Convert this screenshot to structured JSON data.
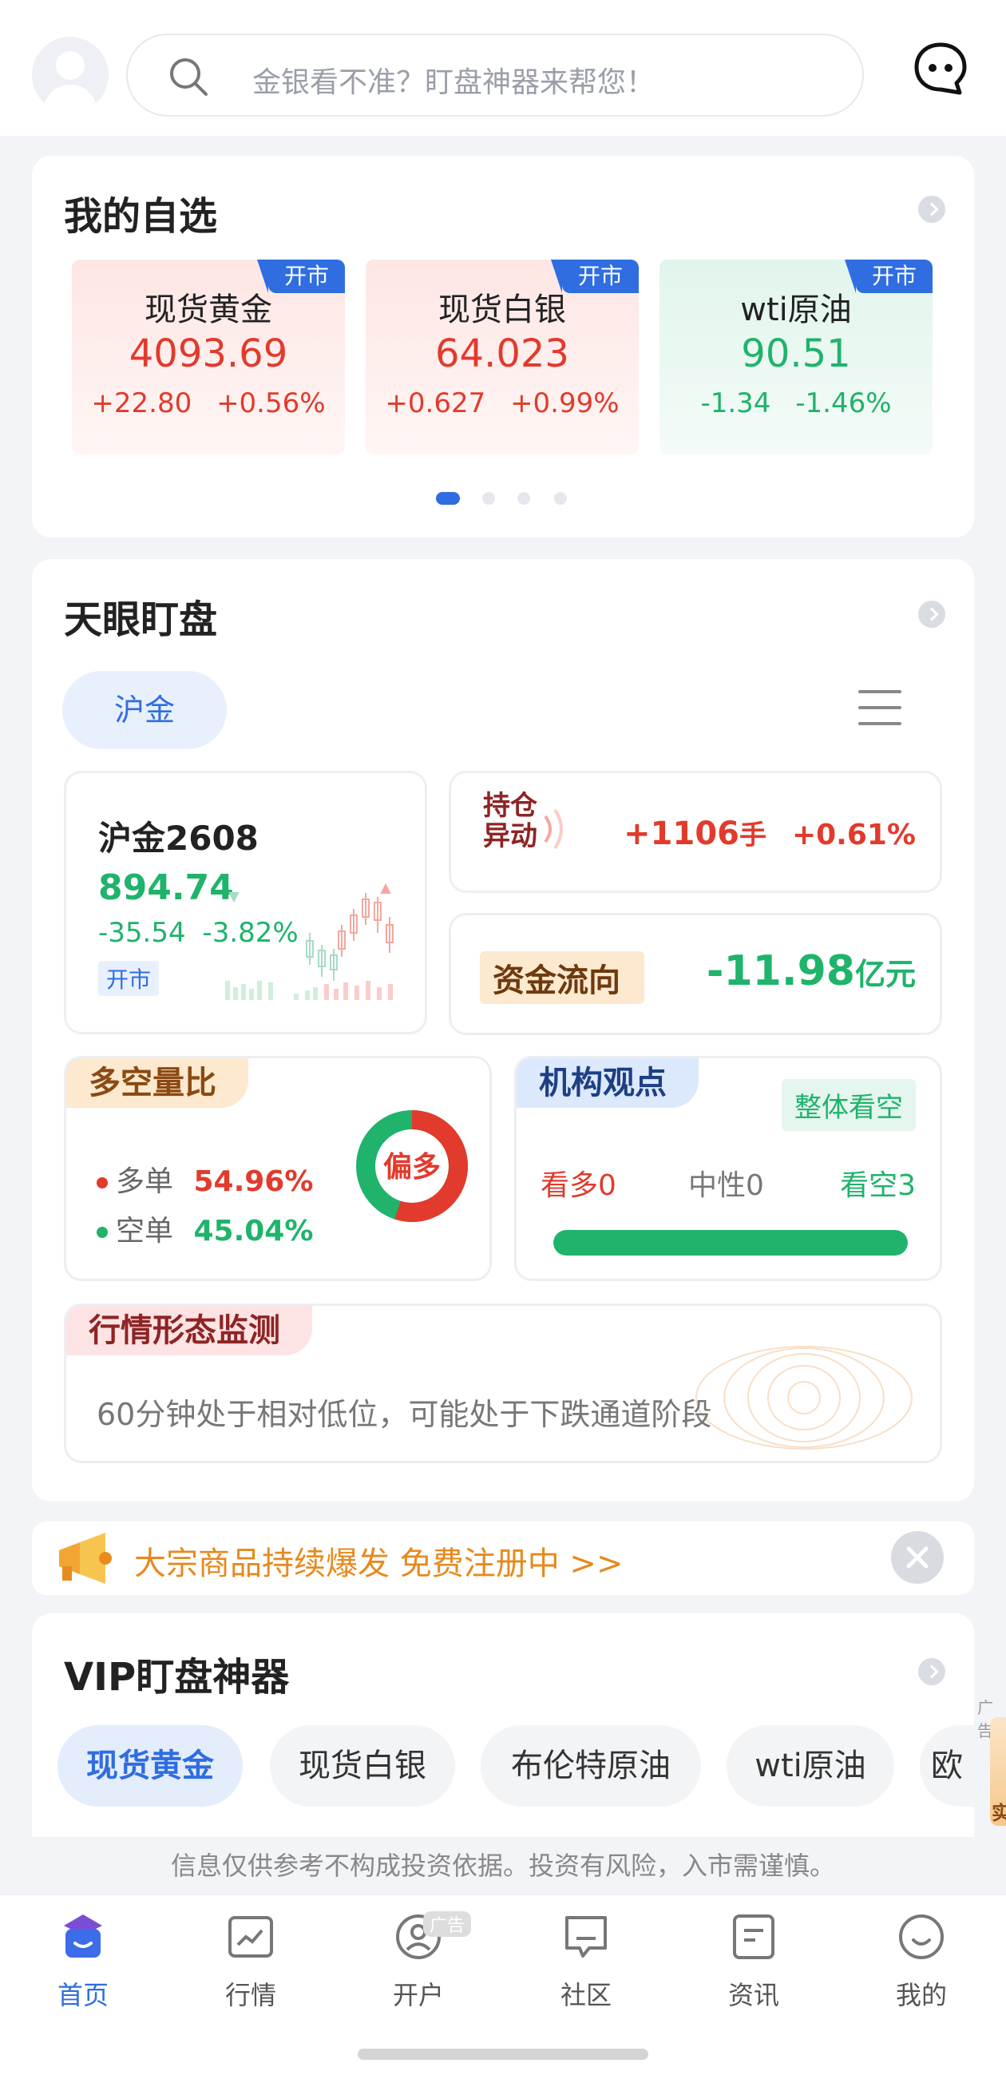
{
  "search": {
    "placeholder": "金银看不准？盯盘神器来帮您！"
  },
  "watchlist": {
    "title": "我的自选",
    "items": [
      {
        "name": "现货黄金",
        "price": "4093.69",
        "change": "+22.80",
        "pct": "+0.56%",
        "status": "开市",
        "trend": "up"
      },
      {
        "name": "现货白银",
        "price": "64.023",
        "change": "+0.627",
        "pct": "+0.99%",
        "status": "开市",
        "trend": "up"
      },
      {
        "name": "wti原油",
        "price": "90.51",
        "change": "-1.34",
        "pct": "-1.46%",
        "status": "开市",
        "trend": "down"
      }
    ],
    "page_count": 4,
    "active_page": 1
  },
  "tianyan": {
    "title": "天眼盯盘",
    "selected_tab": "沪金",
    "contract": {
      "name": "沪金2608",
      "price": "894.74",
      "change": "-35.54",
      "pct": "-3.82%",
      "status": "开市"
    },
    "position": {
      "tag_line1": "持仓",
      "tag_line2": "异动",
      "value": "+1106",
      "unit": "手",
      "pct": "+0.61%"
    },
    "fund_flow": {
      "label": "资金流向",
      "value": "-11.98",
      "unit": "亿元"
    },
    "long_short": {
      "title": "多空量比",
      "long_label": "多单",
      "long_value": "54.96%",
      "short_label": "空单",
      "short_value": "45.04%",
      "bias": "偏多",
      "long_ratio": 0.5496
    },
    "institution": {
      "title": "机构观点",
      "overall": "整体看空",
      "bull": "看多0",
      "neutral": "中性0",
      "bear": "看空3",
      "bear_ratio": 1.0
    },
    "pattern": {
      "title": "行情形态监测",
      "text": "60分钟处于相对低位，可能处于下跌通道阶段"
    }
  },
  "banner": {
    "text": "大宗商品持续爆发  免费注册中 >>"
  },
  "vip": {
    "title": "VIP盯盘神器",
    "tabs": [
      "现货黄金",
      "现货白银",
      "布伦特原油",
      "wti原油",
      "欧"
    ],
    "ad_label": "广告",
    "ad_text": "实"
  },
  "disclaimer": "信息仅供参考不构成投资依据。投资有风险，入市需谨慎。",
  "tabbar": {
    "items": [
      "首页",
      "行情",
      "开户",
      "社区",
      "资讯",
      "我的"
    ],
    "ad_badge": "广告"
  },
  "colors": {
    "up": "#e23a2c",
    "down": "#1fb36b",
    "accent": "#2f6de1"
  }
}
